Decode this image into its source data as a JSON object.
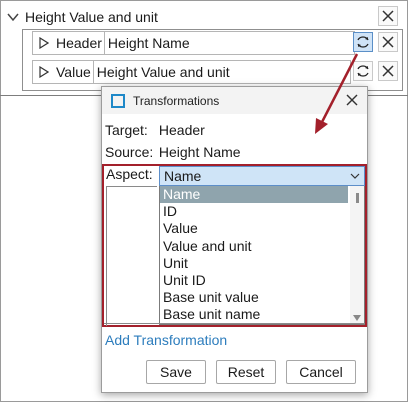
{
  "tree": {
    "root_label": "Height Value and unit",
    "rows": [
      {
        "label": "Header",
        "value": "Height Name"
      },
      {
        "label": "Value",
        "value": "Height Value and unit"
      }
    ]
  },
  "dialog": {
    "title": "Transformations",
    "target_label": "Target:",
    "target_value": "Header",
    "source_label": "Source:",
    "source_value": "Height Name",
    "aspect_label": "Aspect:",
    "aspect_selected": "Name",
    "aspect_options": [
      "Name",
      "ID",
      "Value",
      "Value and unit",
      "Unit",
      "Unit ID",
      "Base unit value",
      "Base unit name"
    ],
    "add_transformation_label": "Add Transformation",
    "buttons": {
      "save": "Save",
      "reset": "Reset",
      "cancel": "Cancel"
    }
  },
  "colors": {
    "highlight_border": "#a3202b",
    "link": "#2d7dbd",
    "selected_option": "#8fa4ad",
    "select_bg": "#cfe4f7"
  },
  "icons": [
    "chevron-down-icon",
    "expand-triangle-icon",
    "transform-icon",
    "close-x-icon",
    "app-window-icon"
  ]
}
